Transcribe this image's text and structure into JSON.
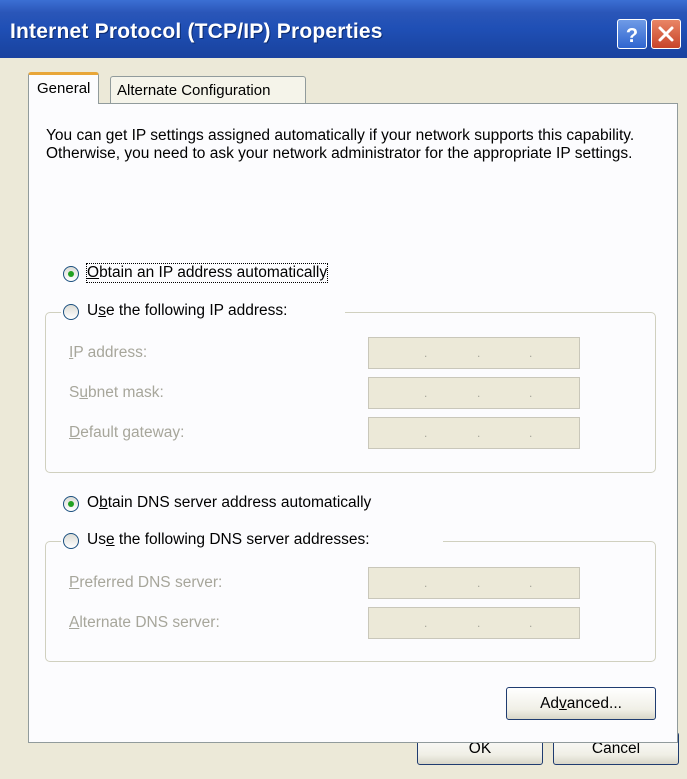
{
  "window": {
    "title": "Internet Protocol (TCP/IP) Properties"
  },
  "titlebar_buttons": {
    "help": "?",
    "close": "close"
  },
  "tabs": [
    {
      "label": "General",
      "selected": true
    },
    {
      "label": "Alternate Configuration",
      "selected": false
    }
  ],
  "description": "You can get IP settings assigned automatically if your network supports this capability. Otherwise, you need to ask your network administrator for the appropriate IP settings.",
  "ip": {
    "auto": {
      "pre": "",
      "key": "O",
      "post": "btain an IP address automatically",
      "selected": true
    },
    "manual": {
      "pre": "U",
      "key": "s",
      "post": "e the following IP address:",
      "selected": false
    },
    "fields": [
      {
        "pre": "",
        "key": "I",
        "post": "P address:",
        "value": ". . ."
      },
      {
        "pre": "S",
        "key": "u",
        "post": "bnet mask:",
        "value": ". . ."
      },
      {
        "pre": "",
        "key": "D",
        "post": "efault gateway:",
        "value": ". . ."
      }
    ]
  },
  "dns": {
    "auto": {
      "pre": "O",
      "key": "b",
      "post": "tain DNS server address automatically",
      "selected": true
    },
    "manual": {
      "pre": "Us",
      "key": "e",
      "post": " the following DNS server addresses:",
      "selected": false
    },
    "fields": [
      {
        "pre": "",
        "key": "P",
        "post": "referred DNS server:",
        "value": ". . ."
      },
      {
        "pre": "",
        "key": "A",
        "post": "lternate DNS server:",
        "value": ". . ."
      }
    ]
  },
  "buttons": {
    "advanced": {
      "pre": "Ad",
      "key": "v",
      "post": "anced..."
    },
    "ok": "OK",
    "cancel": "Cancel"
  },
  "colors": {
    "title_bar": "#1f4fb5",
    "dialog_bg": "#ece9d8",
    "radio_dot": "#21a121",
    "disabled_text": "#a7a69b"
  }
}
